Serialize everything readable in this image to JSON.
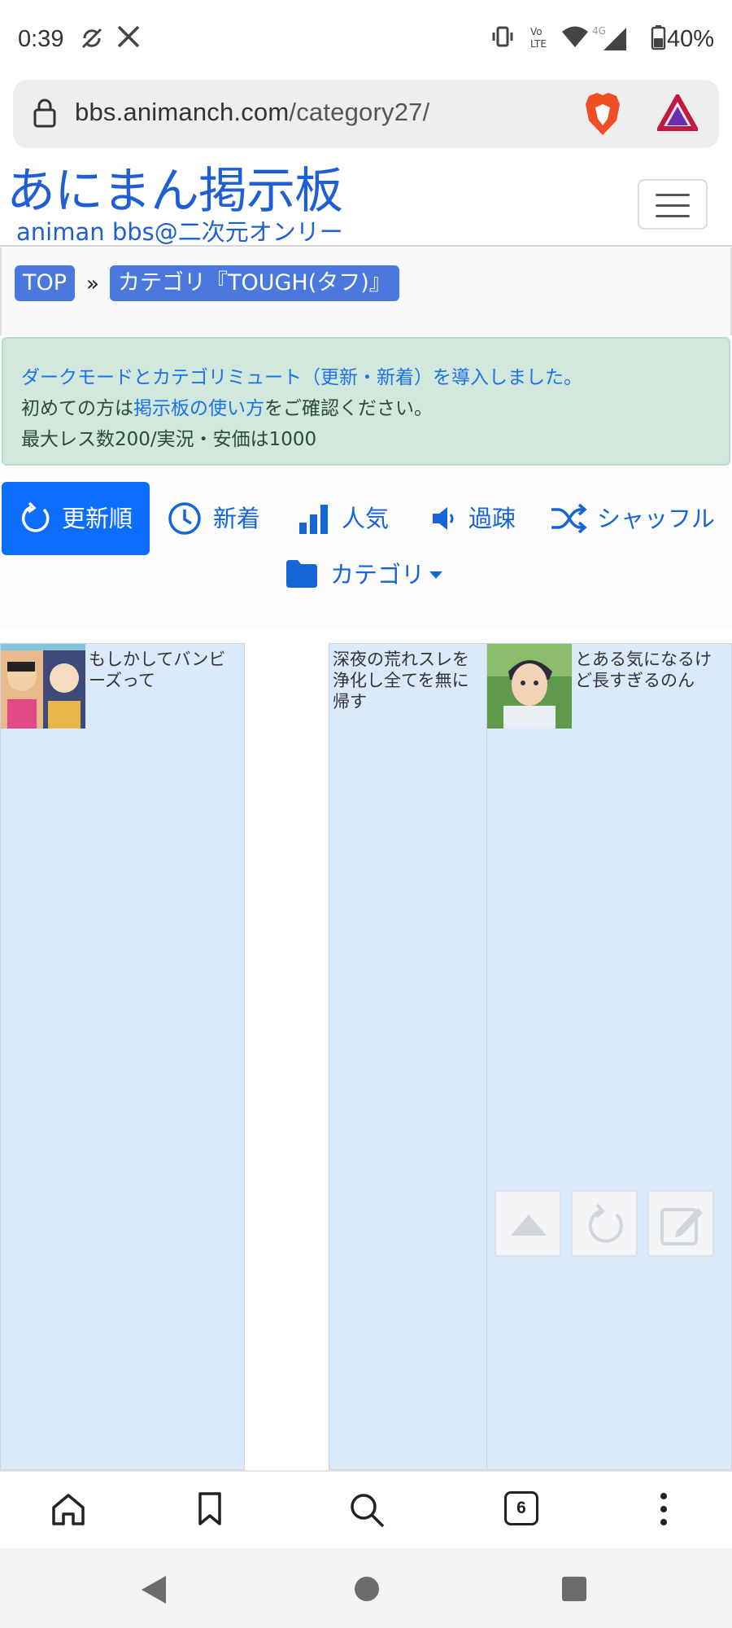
{
  "status_bar": {
    "time": "0:39",
    "battery": "40%"
  },
  "address_bar": {
    "url_host": "bbs.animanch.com",
    "url_path": "/category27/"
  },
  "site": {
    "logo_main": "あにまん掲示板",
    "logo_sub": "animan bbs@二次元オンリー"
  },
  "breadcrumb": {
    "top": "TOP",
    "separator": "»",
    "category": "カテゴリ『TOUGH(タフ)』"
  },
  "notice": {
    "line1": "ダークモードとカテゴリミュート（更新・新着）を導入しました。",
    "line2_pre": "初めての方は",
    "line2_link": "掲示板の使い方",
    "line2_post": "をご確認ください。",
    "line3": "最大レス数200/実況・安価は1000"
  },
  "sort_tabs": [
    {
      "label": "更新順",
      "icon": "refresh-icon",
      "active": true
    },
    {
      "label": "新着",
      "icon": "clock-icon",
      "active": false
    },
    {
      "label": "人気",
      "icon": "bar-chart-icon",
      "active": false
    },
    {
      "label": "過疎",
      "icon": "speaker-icon",
      "active": false
    },
    {
      "label": "シャッフル",
      "icon": "shuffle-icon",
      "active": false
    }
  ],
  "category_dropdown": "カテゴリ",
  "threads": [
    {
      "title_l1": "もしかしてバンビ",
      "title_l2": "ーズって",
      "title_l3": ""
    },
    {
      "title_l1": "深夜の荒れスレを",
      "title_l2": "浄化し全てを無に",
      "title_l3": "帰す"
    },
    {
      "title_l1": "とある気になるけ",
      "title_l2": "ど長すぎるのん",
      "title_l3": ""
    }
  ],
  "bottom_bar": {
    "tab_count": "6"
  },
  "colors": {
    "brand_blue": "#1f5fd6",
    "active_tab": "#0d6efd",
    "notice_bg": "#d2e8dd",
    "thread_bg": "#dbeafb"
  }
}
